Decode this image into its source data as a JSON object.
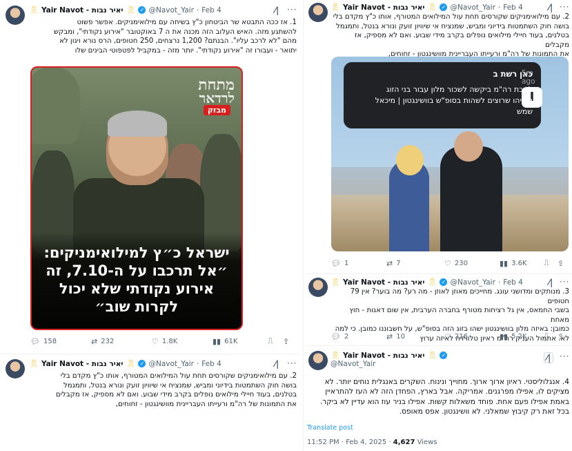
{
  "left": {
    "tweet1": {
      "name": "Yair Navot - יאיר נבות",
      "handle": "@Navot_Yair",
      "date": "Feb 4",
      "text_lines": [
        "1. אז ככה התבטא שר הביטחון כ\"ץ בשיחה עם מילואימניקים. אפשר פשוט",
        "להשתגע מזה. האיש העלוב הזה מכנה את ה 7 באוקטובר \"אירוע נקודתי\", ומבקש",
        "מהם \"לא לרכב עליו\". הבנתם? 1,200 נרצחים, 250 חטופים, הרס נורא ויגון לא",
        "יתואר - ועבורו זה \"אירוע נקודתי\". יותר מזה - במקביל לפטפוטי הבינים שלו"
      ],
      "media": {
        "logo_line1": "מתחת",
        "logo_line2": "לרדאר",
        "badge": "מבזק",
        "headline_lines": [
          "ישראל כ״ץ למילואימניקים:",
          "״אל תרכבו על ה-7.10, זה",
          "אירוע נקודתי שלא יכול",
          "לקרות שוב״"
        ]
      },
      "actions": {
        "replies": "158",
        "reposts": "232",
        "likes": "1.8K",
        "views": "61K"
      }
    },
    "tweet2": {
      "name": "Yair Navot - יאיר נבות",
      "handle": "@Navot_Yair",
      "date": "Feb 4",
      "text_lines": [
        "2. עם מילואימניקים שקורסים תחת עול המילואים המטורף, אותו כ\"ץ מקדם בלי",
        "בושה חוק השתמטות בידיוני ומביש, שמנציח אי שיוויון זועק ונורא בנטל, ותמגמל",
        "בטלנים, בעוד חיילי מילואים נופלים בקרב מידי שבוע. ואם לא מספיק, אז מקבלים",
        "את התמונות של רה\"מ ורעייתו העבריינית מוושינגטון - זחוחים,"
      ]
    }
  },
  "right": {
    "tweet1": {
      "name": "Yair Navot - יאיר נבות",
      "handle": "@Navot_Yair",
      "date": "Feb 4",
      "text_lines": [
        "2. עם מילואימניקים שקורסים תחת עול המילואים המטורף, אותו כ\"ץ מקדם בלי",
        "בושה חוק השתמטות בידיוני ומביש, שמנציח אי שיוויון זועק ונורא בנטל, ותמגמל",
        "בטלנים, בעוד חיילי מילואים נופלים בקרב מידי שבוע. ואם לא מספיק, אז מקבלים",
        "את התמונות של רה\"מ ורעייתו העבריינית מוושינגטון - זחוחים,"
      ],
      "notification": {
        "app": "כאן רשת ב",
        "time": "5m ago",
        "icon": "I",
        "body": "לשכת רה\"מ ביקשה לשכור מלון עבור בני הזוג נתניהו שרוצים לשהות בסופ\"ש בוושינגטון | מיכאל שמש"
      },
      "actions": {
        "replies": "1",
        "reposts": "7",
        "likes": "230",
        "views": "3.6K"
      }
    },
    "tweet2": {
      "name": "Yair Navot - יאיר נבות",
      "handle": "@Navot_Yair",
      "date": "Feb 4",
      "text_lines": [
        "3. מנותקים ומדושני עונג. מחייכים מאוזן לאוזן - מה רע? מה בוער? אין 79 חטופים",
        "בשבי החמאס, אין גל רציחות מטורף בחברה הערבית, אין שום דאגות - חוץ מאחת",
        "כמובן: באיזה מלון בוושינגטון ישהו בזוג הזה בסופ\"ש, על חשבוננו כמובן. כי למה",
        "לא. אתמול העניק רה\"מ ראיון טלוויזיה לאיזה ערוץ"
      ],
      "actions": {
        "replies": "2",
        "reposts": "10",
        "likes": "216",
        "views": "5.2K"
      }
    },
    "tweet3": {
      "name": "Yair Navot - יאיר נבות",
      "handle": "@Navot_Yair",
      "text_lines": [
        "4. אנגלוליסטי. ראיון ארוך ארוך. מחוייך ונינוח. השקרים באנגלית נוחים יותר. לא",
        "מציקים לו, אפילו מפרגנים. אמריקה. אבל בארץ, הפחדן הזה לא העז להתראיין",
        "באמת אפילו פעם אחת. פוחד משאלות קשות. אפילו בניר עוז הוא עדיין לא ביקר.",
        "בכל זאת רק קיבוץ שמאלני. לא וושינגטון. אפס מאופס."
      ],
      "translate": "Translate post",
      "time": "11:52 PM · Feb 4, 2025",
      "views_count": "4,627",
      "views_label": "Views"
    }
  }
}
